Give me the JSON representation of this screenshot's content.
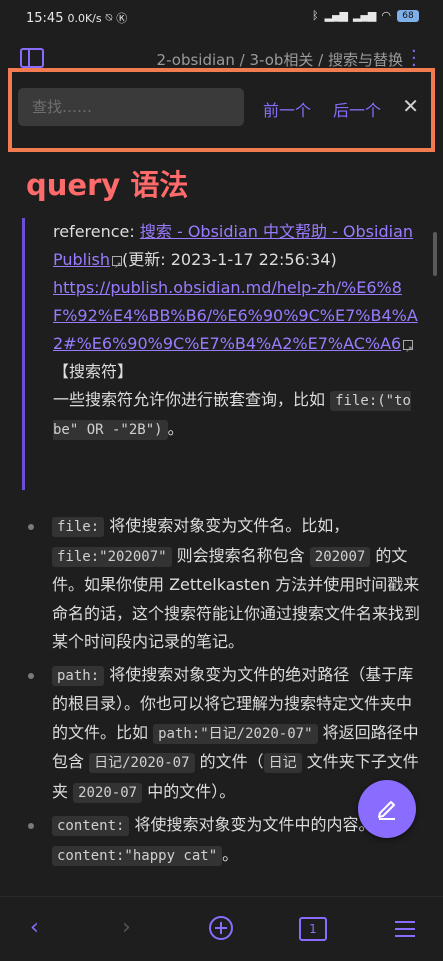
{
  "status": {
    "time": "15:45",
    "speed": "0.0K/s",
    "battery": "68"
  },
  "header": {
    "breadcrumb": [
      "2-obsidian",
      "3-ob相关",
      "搜索与替换"
    ],
    "separator": " / "
  },
  "search": {
    "placeholder": "查找……",
    "prev_label": "前一个",
    "next_label": "后一个"
  },
  "note": {
    "title": "query 语法",
    "reference_prefix": "reference: ",
    "reference_link": "搜索 - Obsidian 中文帮助 - Obsidian Publish",
    "updated": "(更新: 2023-1-17 22:56:34)",
    "url": "https://publish.obsidian.md/help-zh/%E6%8F%92%E4%BB%B6/%E6%90%9C%E7%B4%A2#%E6%90%9C%E7%B4%A2%E7%AC%A6",
    "bracket_heading": "【搜索符】",
    "intro": "一些搜索符允许你进行嵌套查询，比如",
    "intro_code": "file:(\"to be\" OR -\"2B\")",
    "intro_end": "。",
    "items": [
      {
        "code": "file:",
        "t1": " 将使搜索对象变为文件名。比如，",
        "code2": "file:\"202007\"",
        "t2": " 则会搜索名称包含 ",
        "code3": "202007",
        "t3": " 的文件。如果你使用 Zettelkasten 方法并使用时间戳来命名的话，这个搜索符能让你通过搜索文件名来找到某个时间段内记录的笔记。"
      },
      {
        "code": "path:",
        "t1": " 将使搜索对象变为文件的绝对路径（基于库的根目录）。你也可以将它理解为搜索特定文件夹中的文件。比如 ",
        "code2": "path:\"日记/2020-07\"",
        "t2": " 将返回路径中包含 ",
        "code3": "日记/2020-07",
        "t3": " 的文件（",
        "code4": "日记",
        "t4": " 文件夹下子文件夹 ",
        "code5": "2020-07",
        "t5": " 中的文件）。"
      },
      {
        "code": "content:",
        "t1": " 将使搜索对象变为文件中的内容。比如 ",
        "code2": "content:\"happy cat\"",
        "t2": "。"
      }
    ]
  },
  "bottom": {
    "tab_count": "1"
  },
  "icons": [
    "back-icon",
    "forward-icon",
    "new-note-icon",
    "tabs-icon",
    "menu-icon",
    "edit-icon",
    "close-icon",
    "sidebar-icon",
    "more-icon"
  ]
}
